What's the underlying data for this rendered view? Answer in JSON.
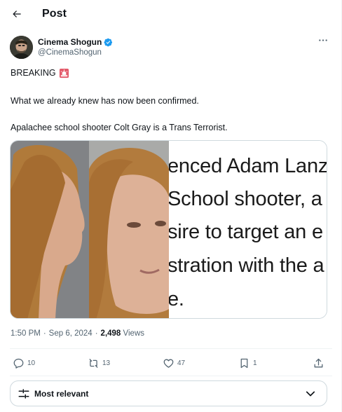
{
  "header": {
    "title": "Post",
    "back_icon": "arrow-left-icon"
  },
  "author": {
    "name": "Cinema Shogun",
    "handle": "@CinemaShogun",
    "verified": true,
    "verified_color": "#1d9bf0"
  },
  "tweet": {
    "line1": "BREAKING",
    "line1_emoji": "siren-icon",
    "line2": "What we already knew has now been confirmed.",
    "line3": "Apalachee school shooter Colt Gray is a Trans Terrorist."
  },
  "media": {
    "caption_lines": [
      "enced Adam Lanz",
      "School shooter, a",
      "sire to target an e",
      "stration with the a",
      "e."
    ]
  },
  "meta": {
    "time": "1:50 PM",
    "date": "Sep 6, 2024",
    "views_count": "2,498",
    "views_label": "Views",
    "dot": "·"
  },
  "actions": {
    "replies": "10",
    "reposts": "13",
    "likes": "47",
    "bookmarks": "1"
  },
  "sort": {
    "label": "Most relevant"
  },
  "colors": {
    "text": "#0f1419",
    "secondary": "#536471",
    "border": "#cfd9de",
    "accent": "#1d9bf0"
  }
}
